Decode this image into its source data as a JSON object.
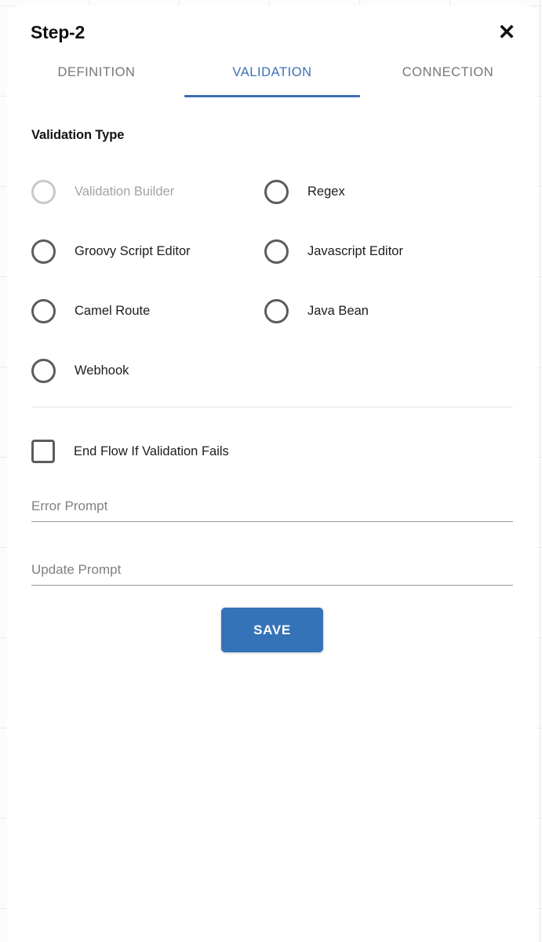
{
  "dialog": {
    "title": "Step-2",
    "close_icon": "close-icon",
    "close_glyph": "✕"
  },
  "tabs": {
    "active_color": "#3b6fb5",
    "inactive_color": "#777777",
    "items": [
      {
        "label": "DEFINITION",
        "active": false
      },
      {
        "label": "VALIDATION",
        "active": true
      },
      {
        "label": "CONNECTION",
        "active": false
      }
    ]
  },
  "validation": {
    "section_label": "Validation Type",
    "options": [
      {
        "label": "Validation Builder",
        "selected": false,
        "disabled": true,
        "column": "left"
      },
      {
        "label": "Regex",
        "selected": false,
        "disabled": false,
        "column": "right"
      },
      {
        "label": "Groovy Script Editor",
        "selected": false,
        "disabled": false,
        "column": "left"
      },
      {
        "label": "Javascript Editor",
        "selected": false,
        "disabled": false,
        "column": "right"
      },
      {
        "label": "Camel Route",
        "selected": false,
        "disabled": false,
        "column": "left"
      },
      {
        "label": "Java Bean",
        "selected": false,
        "disabled": false,
        "column": "right"
      },
      {
        "label": "Webhook",
        "selected": false,
        "disabled": false,
        "column": "left"
      }
    ]
  },
  "end_flow": {
    "label": "End Flow If Validation Fails",
    "checked": false
  },
  "fields": {
    "error_prompt": {
      "placeholder": "Error Prompt",
      "value": ""
    },
    "update_prompt": {
      "placeholder": "Update Prompt",
      "value": ""
    }
  },
  "actions": {
    "save_label": "SAVE",
    "save_color": "#3573b9"
  }
}
